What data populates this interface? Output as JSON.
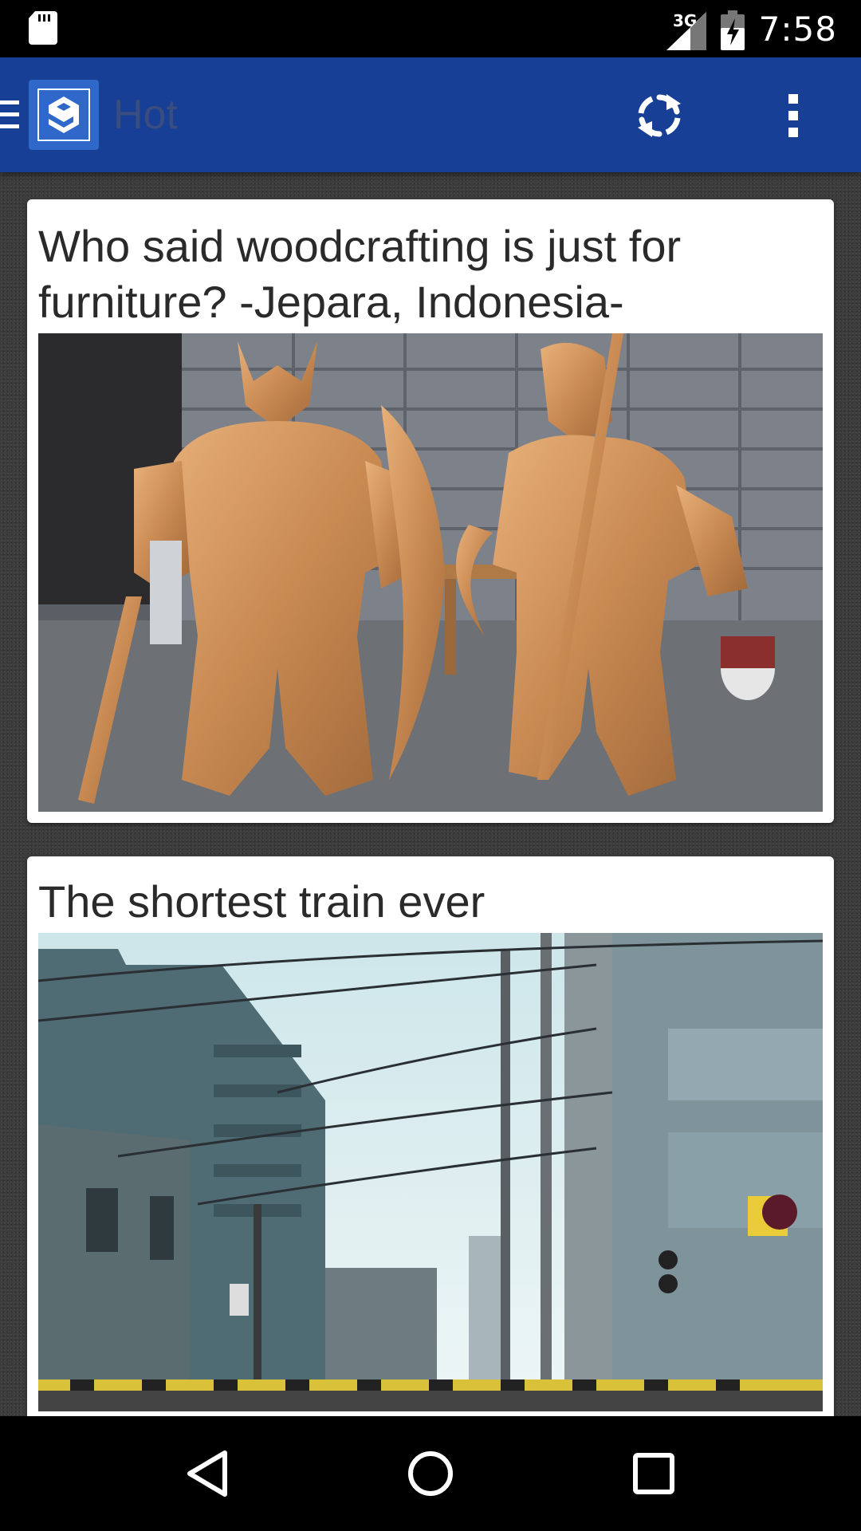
{
  "status_bar": {
    "network_type": "3G",
    "time": "7:58"
  },
  "app_bar": {
    "title": "Hot",
    "icons": {
      "menu": "menu-icon",
      "logo": "9gag-logo",
      "refresh": "refresh-icon",
      "overflow": "more-vert-icon"
    },
    "colors": {
      "bar": "#173f95",
      "logo_bg": "#2f68c8"
    }
  },
  "feed": {
    "posts": [
      {
        "title": "Who said woodcrafting is just for furniture? -Jepara, Indonesia-",
        "image": "Two large carved wooden armored warrior statues standing side by side in front of a grey cinderblock wall"
      },
      {
        "title": "The shortest train ever",
        "image": "Street view of a Japanese neighborhood with apartment buildings, utility poles, overhead wires and a railway crossing"
      }
    ]
  },
  "nav_bar": {
    "icons": [
      "back-icon",
      "home-icon",
      "recents-icon"
    ]
  }
}
